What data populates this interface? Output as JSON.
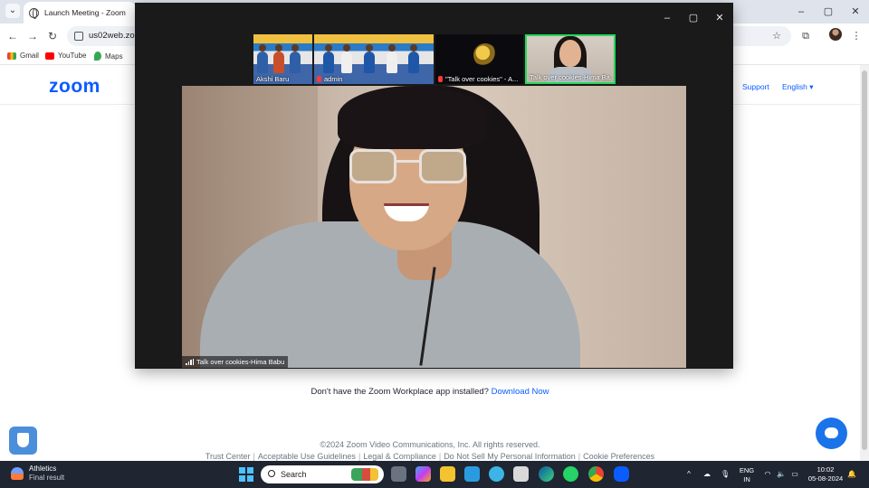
{
  "browser": {
    "tab_title": "Launch Meeting - Zoom",
    "url": "us02web.zoo",
    "bookmarks": [
      "Gmail",
      "YouTube",
      "Maps"
    ]
  },
  "zoom_page": {
    "logo": "zoom",
    "support": "Support",
    "language": "English",
    "download_prompt": "Don't have the Zoom Workplace app installed?",
    "download_link": "Download Now",
    "copyright": "©2024 Zoom Video Communications, Inc. All rights reserved.",
    "footer_links": [
      "Trust Center",
      "Acceptable Use Guidelines",
      "Legal & Compliance",
      "Do Not Sell My Personal Information",
      "Cookie Preferences"
    ]
  },
  "meeting": {
    "participants": [
      {
        "name": "Akshi Baru",
        "muted": false,
        "active": false
      },
      {
        "name": "admin",
        "muted": true,
        "active": false
      },
      {
        "name": "\"Talk over cookies\" - A...",
        "muted": true,
        "active": false
      },
      {
        "name": "Talk over cookies-Hima Ba...",
        "muted": false,
        "active": true
      }
    ],
    "speaker_label": "Talk over cookies-Hima Babu"
  },
  "taskbar": {
    "weather_title": "Athletics",
    "weather_sub": "Final result",
    "search_placeholder": "Search",
    "lang_line1": "ENG",
    "lang_line2": "IN",
    "time": "10:02",
    "date": "05-08-2024"
  }
}
